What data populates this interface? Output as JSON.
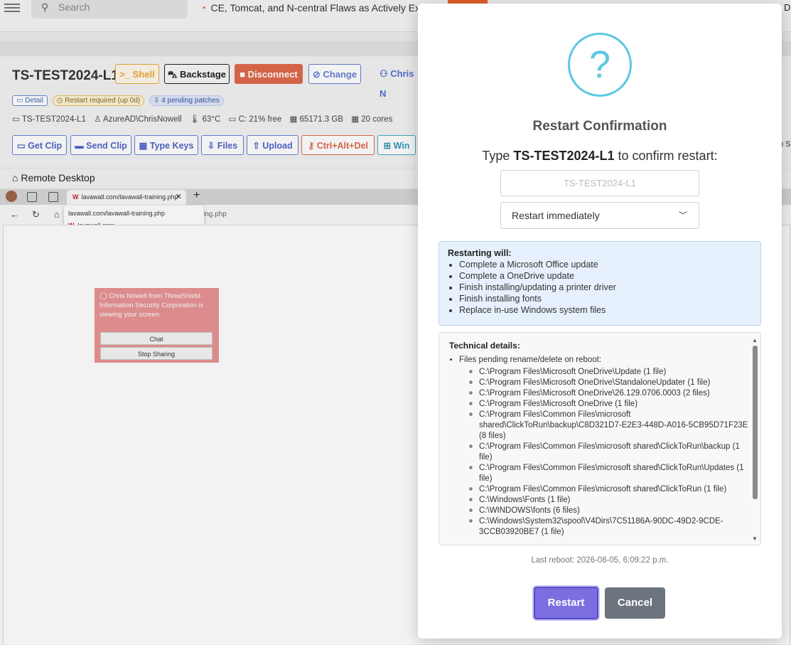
{
  "topbar": {
    "search_placeholder": "Search",
    "ticker": "CE, Tomcat, and N-central Flaws as Actively Exploit",
    "right_fragment": "D"
  },
  "device": {
    "name": "TS-TEST2024-L1",
    "buttons": {
      "shell": ">_ Shell",
      "backstage": "⛍ Backstage",
      "disconnect": "■ Disconnect",
      "change": "⊘ Change",
      "user": "⚇ Chris N"
    },
    "badges": {
      "detail": "▭ Detail",
      "restart_required": "◷ Restart required (up 0d)",
      "pending_patches": "⇩ 4 pending patches"
    },
    "stats": {
      "host": "▭ TS-TEST2024-L1",
      "user": "♙ AzureAD\\ChrisNowell",
      "temp": "🌡 63°C",
      "disk": "▭ C: 21% free",
      "mem": "▦ 65171.3 GB",
      "cores": "▦ 20 cores"
    },
    "actions": {
      "get_clip": "▭ Get Clip",
      "send_clip": "▬ Send Clip",
      "type_keys": "▦ Type Keys",
      "files": "⇩ Files",
      "upload": "⇧ Upload",
      "ctrl_alt_del": "⚷ Ctrl+Alt+Del",
      "win": "⊞ Win"
    },
    "right_fragment": "p S"
  },
  "remote": {
    "label": "⌂ Remote Desktop",
    "tab_title": "lavawall.com/lavawall-training.php",
    "address_fragment": "ing.php",
    "dropdown": {
      "url": "lavawall.com/lavawall-training.php",
      "site": "lavawall.com"
    },
    "share": {
      "text": "Chris Nowell from ThreeShield Information Security Corporation is viewing your screen.",
      "chat": "Chat",
      "stop": "Stop Sharing"
    }
  },
  "modal": {
    "icon": "?",
    "title": "Restart Confirmation",
    "prompt_prefix": "Type",
    "prompt_device": "TS-TEST2024-L1",
    "prompt_suffix": "to confirm restart:",
    "input_placeholder": "TS-TEST2024-L1",
    "select_value": "Restart immediately",
    "restarting_title": "Restarting will:",
    "restarting_items": [
      "Complete a Microsoft Office update",
      "Complete a OneDrive update",
      "Finish installing/updating a printer driver",
      "Finish installing fonts",
      "Replace in-use Windows system files"
    ],
    "tech_title": "Technical details:",
    "tech_intro": "Files pending rename/delete on reboot:",
    "tech_files": [
      "C:\\Program Files\\Microsoft OneDrive\\Update (1 file)",
      "C:\\Program Files\\Microsoft OneDrive\\StandaloneUpdater (1 file)",
      "C:\\Program Files\\Microsoft OneDrive\\26.129.0706.0003 (2 files)",
      "C:\\Program Files\\Microsoft OneDrive (1 file)",
      "C:\\Program Files\\Common Files\\microsoft shared\\ClickToRun\\backup\\C8D321D7-E2E3-448D-A016-5CB95D71F23E (8 files)",
      "C:\\Program Files\\Common Files\\microsoft shared\\ClickToRun\\backup (1 file)",
      "C:\\Program Files\\Common Files\\microsoft shared\\ClickToRun\\Updates (1 file)",
      "C:\\Program Files\\Common Files\\microsoft shared\\ClickToRun (1 file)",
      "C:\\Windows\\Fonts (1 file)",
      "C:\\WINDOWS\\fonts (6 files)",
      "C:\\Windows\\System32\\spool\\V4Dirs\\7C51186A-90DC-49D2-9CDE-3CCB03920BE7 (1 file)"
    ],
    "last_reboot": "Last reboot: 2026-08-05, 6:09:22 p.m.",
    "restart_label": "Restart",
    "cancel_label": "Cancel"
  }
}
